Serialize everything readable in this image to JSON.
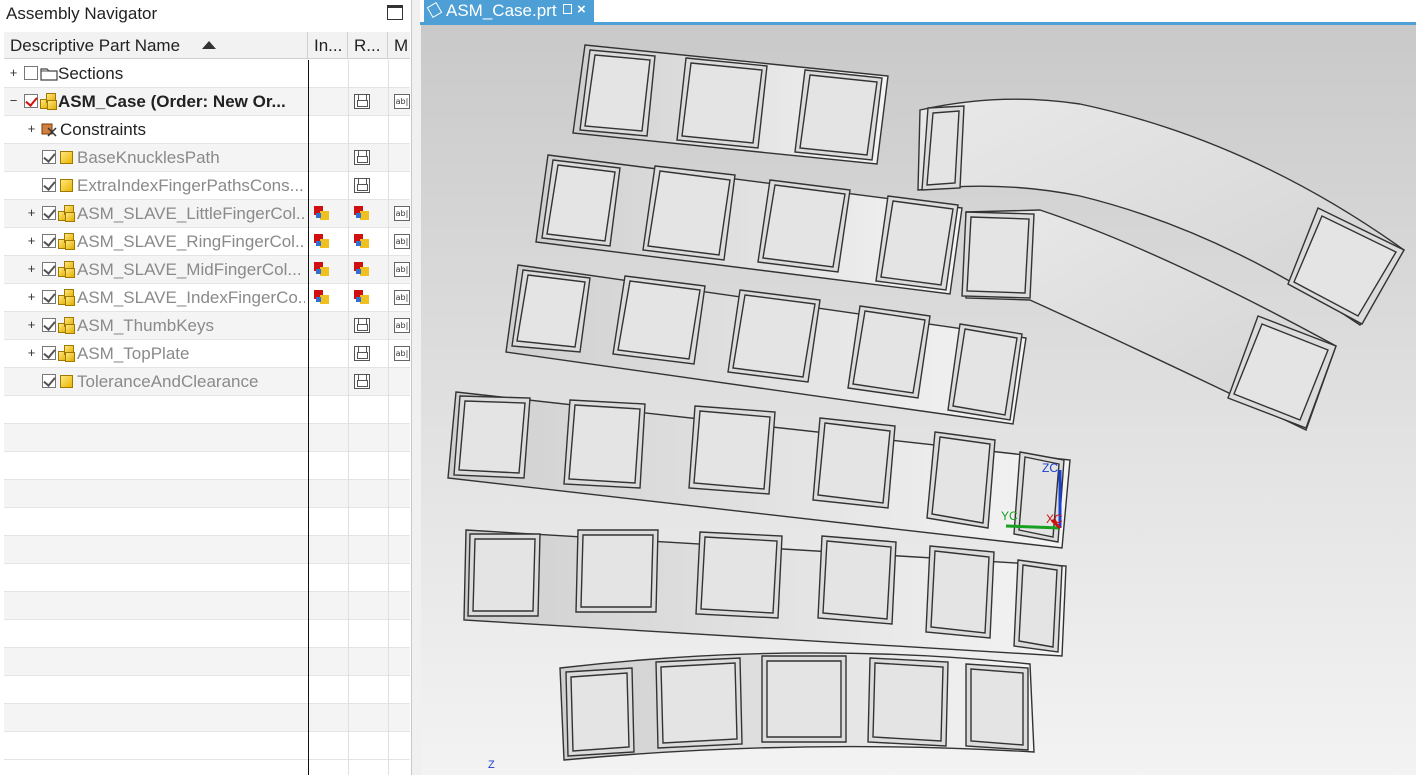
{
  "navigator": {
    "title": "Assembly Navigator",
    "columns": [
      "Descriptive Part Name",
      "In...",
      "R...",
      "M"
    ],
    "rows": [
      {
        "name": "Sections",
        "expander": "+",
        "checked": false,
        "style": "normal"
      },
      {
        "name": "ASM_Case (Order: New Or...",
        "expander": "−",
        "checked": true,
        "style": "bold"
      },
      {
        "name": "Constraints",
        "expander": "+",
        "style": "normal"
      },
      {
        "name": "BaseKnucklesPath",
        "checked": true,
        "style": "gray"
      },
      {
        "name": "ExtraIndexFingerPathsCons...",
        "checked": true,
        "style": "gray"
      },
      {
        "name": "ASM_SLAVE_LittleFingerCol...",
        "expander": "+",
        "checked": true,
        "style": "gray"
      },
      {
        "name": "ASM_SLAVE_RingFingerCol...",
        "expander": "+",
        "checked": true,
        "style": "gray"
      },
      {
        "name": "ASM_SLAVE_MidFingerCol...",
        "expander": "+",
        "checked": true,
        "style": "gray"
      },
      {
        "name": "ASM_SLAVE_IndexFingerCo...",
        "expander": "+",
        "checked": true,
        "style": "gray"
      },
      {
        "name": "ASM_ThumbKeys",
        "expander": "+",
        "checked": true,
        "style": "gray"
      },
      {
        "name": "ASM_TopPlate",
        "expander": "+",
        "checked": true,
        "style": "gray"
      },
      {
        "name": "ToleranceAndClearance",
        "checked": true,
        "style": "gray"
      }
    ]
  },
  "viewport": {
    "tab_label": "ASM_Case.prt",
    "triad": {
      "z_label": "ZC",
      "y_label": "YC",
      "x_label": "XC",
      "corner_label": "Z"
    }
  },
  "colors": {
    "tab": "#4d9fd6",
    "accent_red": "#d01010",
    "part_yellow": "#e8b800"
  }
}
